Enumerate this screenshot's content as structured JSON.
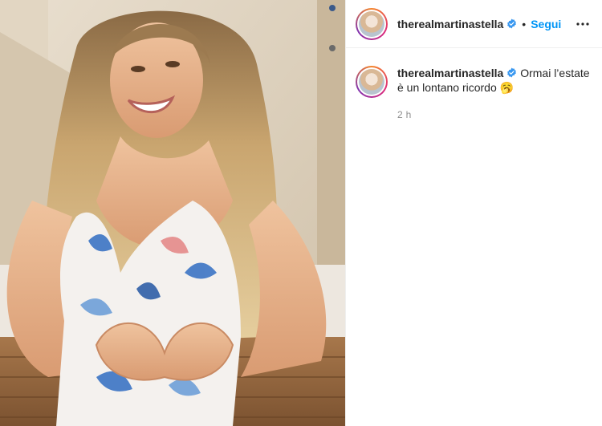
{
  "post": {
    "author": {
      "username": "therealmartinastella",
      "verified_icon": "verified-badge-icon",
      "separator": "•",
      "follow_label": "Segui"
    },
    "more_icon": "more-options-icon",
    "caption": {
      "username": "therealmartinastella",
      "text": "Ormai l’estate è un lontano ricordo 🥱",
      "time": "2 h"
    },
    "photo": {
      "description_icon": "post-photo"
    }
  },
  "colors": {
    "accent": "#0095f6",
    "verified": "#3897f0",
    "secondary_text": "#8e8e8e",
    "divider": "#efefef"
  }
}
